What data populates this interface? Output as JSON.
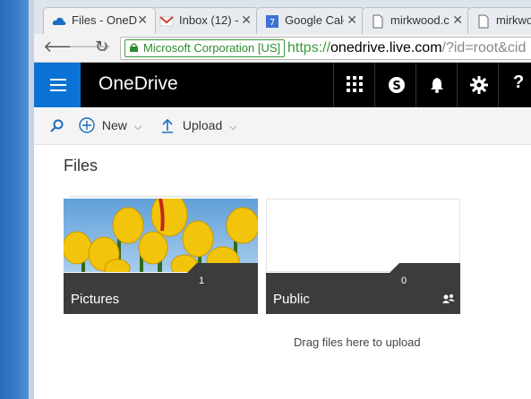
{
  "browser": {
    "tabs": [
      {
        "title": "Files - OneD",
        "icon": "onedrive-cloud-icon",
        "active": true
      },
      {
        "title": "Inbox (12) -",
        "icon": "gmail-icon",
        "active": false
      },
      {
        "title": "Google Cale",
        "icon": "google-calendar-icon",
        "active": false
      },
      {
        "title": "mirkwood.c",
        "icon": "page-icon",
        "active": false
      },
      {
        "title": "mirkwo",
        "icon": "page-icon",
        "active": false
      }
    ],
    "ev_label": "Microsoft Corporation [US]",
    "url_scheme": "https://",
    "url_host": "onedrive.live.com",
    "url_rest": "/?id=root&cid"
  },
  "app": {
    "title": "OneDrive",
    "accent": "#0b73d6"
  },
  "commands": {
    "new_label": "New",
    "upload_label": "Upload"
  },
  "content": {
    "heading": "Files",
    "folders": [
      {
        "name": "Pictures",
        "count": "1"
      },
      {
        "name": "Public",
        "count": "0"
      }
    ],
    "drop_hint": "Drag files here to upload"
  }
}
